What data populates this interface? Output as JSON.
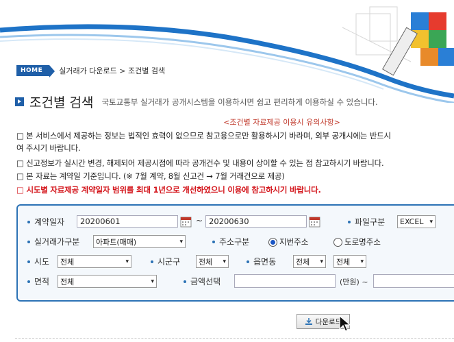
{
  "breadcrumb": {
    "home": "HOME",
    "path": "실거래가 다운로드 > 조건별 검색"
  },
  "title": "조건별 검색",
  "subtitle": "국토교통부 실거래가 공개시스템을 이용하시면 쉽고 편리하게 이용하실 수 있습니다.",
  "notice": {
    "heading": "<조건별 자료제공 이용시 유의사항>",
    "lines": [
      "□ 본 서비스에서 제공하는 정보는 법적인 효력이 없으므로 참고용으로만 활용하시기 바라며, 외부 공개시에는 반드시",
      "여 주시기 바랍니다.",
      "□ 신고정보가 실시간 변경, 해제되어 제공시점에 따라 공개건수 및 내용이 상이할 수 있는 점 참고하시기 바랍니다.",
      "□ 본 자료는 계약일 기준입니다. (※ 7월 계약, 8월 신고건 → 7월 거래건으로 제공)",
      "□ 시도별 자료제공 계약일자 범위를 최대 1년으로 개선하였으니 이용에 참고하시기 바랍니다."
    ]
  },
  "form": {
    "contract_date_label": "계약일자",
    "date_from": "20200601",
    "date_sep": "~",
    "date_to": "20200630",
    "file_type_label": "파일구분",
    "file_type_value": "EXCEL",
    "price_type_label": "실거래가구분",
    "price_type_value": "아파트(매매)",
    "address_type_label": "주소구분",
    "address_options": [
      "지번주소",
      "도로명주소"
    ],
    "address_selected": 0,
    "sido_label": "시도",
    "sido_value": "전체",
    "sigungu_label": "시군구",
    "sigungu_value": "전체",
    "eupmyeondong_label": "읍면동",
    "eupmyeondong_value": "전체",
    "eupmyeondong_value2": "전체",
    "area_label": "면적",
    "area_value": "전체",
    "amount_label": "금액선택",
    "amount_from": "",
    "amount_unit": "(만원) ~",
    "amount_to": ""
  },
  "download_label": "다운로드",
  "colors": {
    "accent": "#1f5fa8",
    "panel_border": "#2b72b5",
    "warning_red": "#d4161c"
  },
  "icons": [
    "home-badge",
    "calendar-icon",
    "download-icon",
    "cursor-arrow-icon"
  ]
}
